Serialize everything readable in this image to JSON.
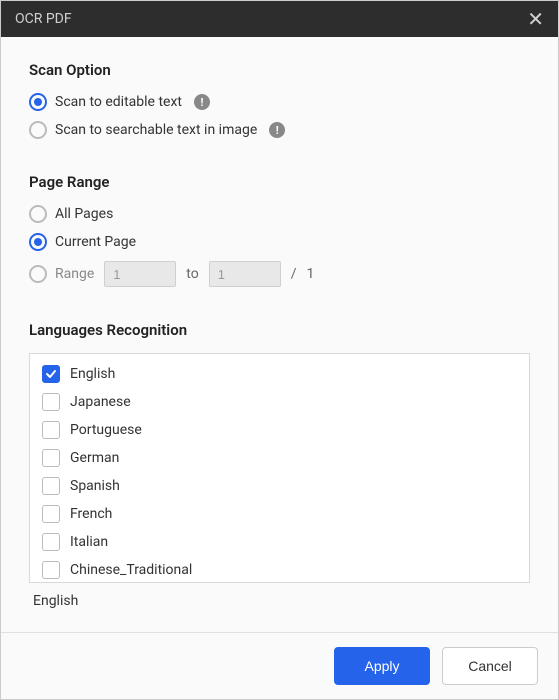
{
  "title": "OCR PDF",
  "sections": {
    "scan": {
      "title": "Scan Option",
      "options": [
        {
          "label": "Scan to editable text",
          "selected": true,
          "info": true
        },
        {
          "label": "Scan to searchable text in image",
          "selected": false,
          "info": true
        }
      ]
    },
    "page_range": {
      "title": "Page Range",
      "all_pages": {
        "label": "All Pages",
        "selected": false
      },
      "current_page": {
        "label": "Current Page",
        "selected": true
      },
      "range": {
        "label": "Range",
        "selected": false,
        "from": "1",
        "to_label": "to",
        "to": "1",
        "total_sep": "/",
        "total": "1"
      }
    },
    "languages": {
      "title": "Languages Recognition",
      "items": [
        {
          "label": "English",
          "checked": true
        },
        {
          "label": "Japanese",
          "checked": false
        },
        {
          "label": "Portuguese",
          "checked": false
        },
        {
          "label": "German",
          "checked": false
        },
        {
          "label": "Spanish",
          "checked": false
        },
        {
          "label": "French",
          "checked": false
        },
        {
          "label": "Italian",
          "checked": false
        },
        {
          "label": "Chinese_Traditional",
          "checked": false
        }
      ],
      "selected_summary": "English"
    }
  },
  "footer": {
    "apply": "Apply",
    "cancel": "Cancel"
  }
}
